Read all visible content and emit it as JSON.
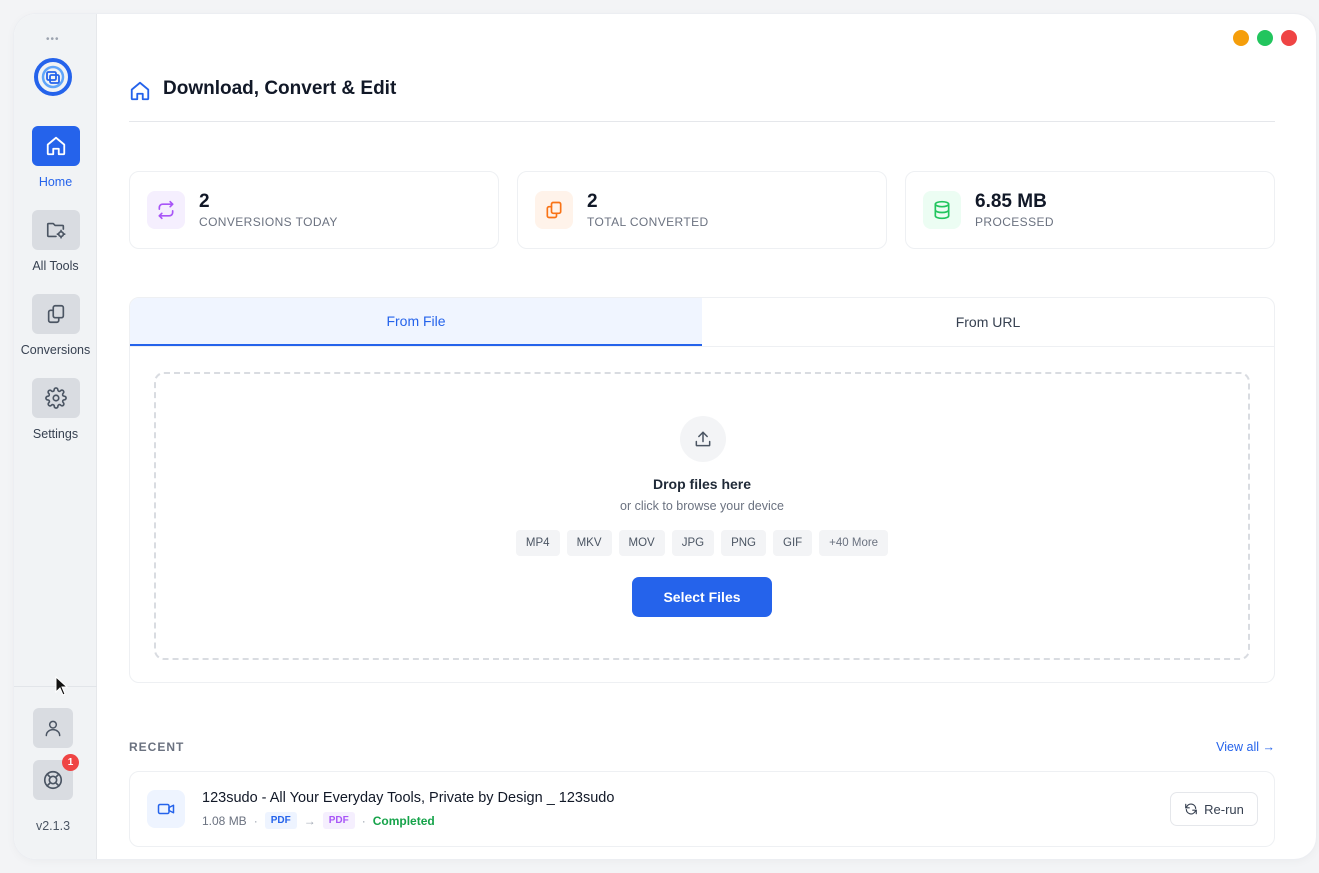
{
  "window": {
    "controls": [
      {
        "name": "minimize",
        "color": "#f59e0b"
      },
      {
        "name": "maximize",
        "color": "#22c55e"
      },
      {
        "name": "close",
        "color": "#ef4444"
      }
    ]
  },
  "sidebar": {
    "items": [
      {
        "label": "Home",
        "icon": "home-icon",
        "active": true
      },
      {
        "label": "All Tools",
        "icon": "folder-settings-icon",
        "active": false
      },
      {
        "label": "Conversions",
        "icon": "copy-icon",
        "active": false
      },
      {
        "label": "Settings",
        "icon": "gear-icon",
        "active": false
      }
    ],
    "notification_count": "1",
    "version": "v2.1.3"
  },
  "header": {
    "title": "Download, Convert & Edit"
  },
  "stats": [
    {
      "value": "2",
      "label": "CONVERSIONS TODAY",
      "icon": "repeat-icon",
      "color": "#a855f7"
    },
    {
      "value": "2",
      "label": "TOTAL CONVERTED",
      "icon": "copy-icon",
      "color": "#f97316"
    },
    {
      "value": "6.85 MB",
      "label": "PROCESSED",
      "icon": "database-icon",
      "color": "#22c55e"
    }
  ],
  "converter": {
    "tabs": [
      "From File",
      "From URL"
    ],
    "active_tab": "From File",
    "dropzone": {
      "title": "Drop files here",
      "subtitle": "or click to browse your device",
      "formats": [
        "MP4",
        "MKV",
        "MOV",
        "JPG",
        "PNG",
        "GIF",
        "+40 More"
      ],
      "button": "Select Files"
    }
  },
  "recent": {
    "title": "RECENT",
    "view_all": "View all →",
    "items": [
      {
        "name": "123sudo - All Your Everyday Tools, Private by Design _ 123sudo",
        "size": "1.08 MB",
        "from": "PDF",
        "to": "PDF",
        "status": "Completed",
        "action": "Re-run"
      }
    ]
  },
  "colors": {
    "accent": "#2563eb",
    "success": "#16a34a",
    "badge": "#ef4444"
  }
}
